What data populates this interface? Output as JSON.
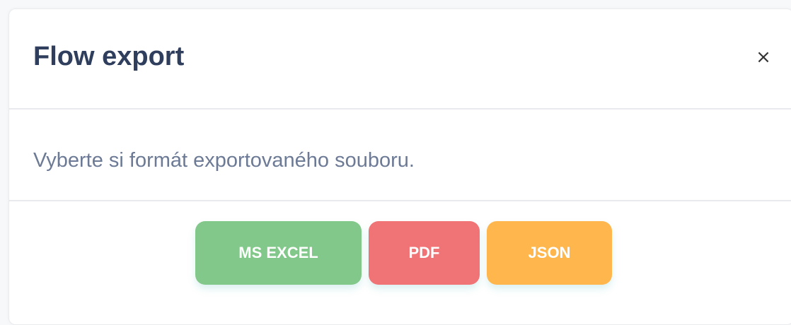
{
  "modal": {
    "title": "Flow export",
    "close_label": "×",
    "body_text": "Vyberte si formát exportovaného souboru."
  },
  "buttons": {
    "excel_label": "MS EXCEL",
    "pdf_label": "PDF",
    "json_label": "JSON"
  },
  "colors": {
    "title": "#2e3e5c",
    "body_text": "#6c7a95",
    "excel": "#82c88a",
    "pdf": "#f07375",
    "json": "#ffb74d"
  }
}
